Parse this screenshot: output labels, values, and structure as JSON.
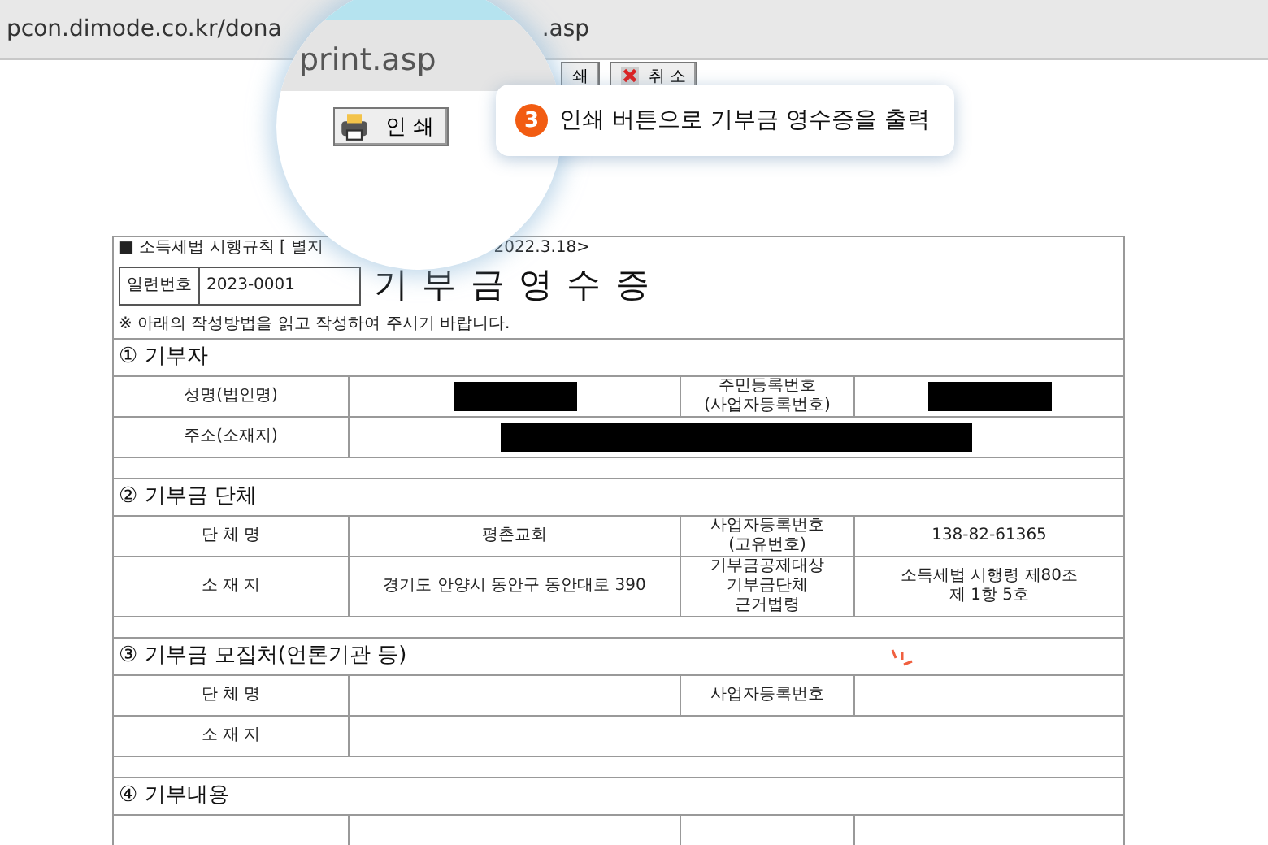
{
  "address_bar": {
    "url_start": "pcon.dimode.co.kr/dona",
    "url_end": ".asp"
  },
  "toolbar": {
    "print_label": "쇄",
    "cancel_label": "취 소"
  },
  "magnifier": {
    "url": "print.asp",
    "button": "인 쇄"
  },
  "callout": {
    "step": "3",
    "text": "인쇄 버튼으로 기부금 영수증을 출력"
  },
  "form": {
    "rule_start": "■ 소득세법 시행규칙 [ 별지",
    "rule_end": "2022.3.18>",
    "serial_label": "일련번호",
    "serial_value": "2023-0001",
    "title": "기 부 금 영 수 증",
    "note": "※ 아래의 작성방법을 읽고 작성하여 주시기 바랍니다.",
    "sections": [
      {
        "title": "① 기부자",
        "rows": [
          {
            "cells": [
              {
                "kind": "label",
                "text": "성명(법인명)"
              },
              {
                "kind": "redacted"
              },
              {
                "kind": "label",
                "text": "주민등록번호\n(사업자등록번호)"
              },
              {
                "kind": "redacted"
              }
            ]
          },
          {
            "cells": [
              {
                "kind": "label",
                "text": "주소(소재지)"
              },
              {
                "kind": "redacted"
              }
            ]
          }
        ]
      },
      {
        "title": "② 기부금 단체",
        "rows": [
          {
            "cells": [
              {
                "kind": "label",
                "text": "단 체 명"
              },
              {
                "kind": "value",
                "text": "평촌교회"
              },
              {
                "kind": "label",
                "text": "사업자등록번호\n(고유번호)"
              },
              {
                "kind": "value",
                "text": "138-82-61365"
              }
            ]
          },
          {
            "cells": [
              {
                "kind": "label",
                "text": "소 재 지"
              },
              {
                "kind": "value",
                "text": "경기도 안양시 동안구 동안대로 390"
              },
              {
                "kind": "label",
                "text": "기부금공제대상\n기부금단체\n근거법령"
              },
              {
                "kind": "value",
                "text": "소득세법 시행령 제80조\n제 1항 5호"
              }
            ]
          }
        ]
      },
      {
        "title": "③ 기부금 모집처(언론기관 등)",
        "rows": [
          {
            "cells": [
              {
                "kind": "label",
                "text": "단 체 명"
              },
              {
                "kind": "empty"
              },
              {
                "kind": "label",
                "text": "사업자등록번호"
              },
              {
                "kind": "empty"
              }
            ]
          },
          {
            "cells": [
              {
                "kind": "label",
                "text": "소 재 지"
              },
              {
                "kind": "empty"
              }
            ]
          }
        ]
      },
      {
        "title": "④ 기부내용"
      }
    ]
  }
}
